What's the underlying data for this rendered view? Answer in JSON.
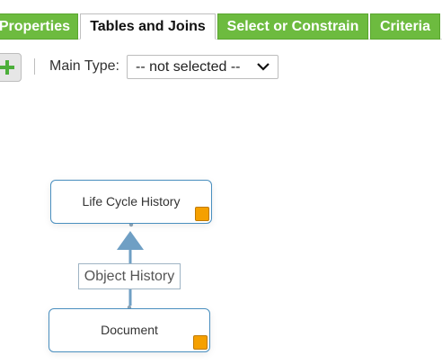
{
  "tabs": [
    {
      "label": "Properties",
      "active": false
    },
    {
      "label": "Tables and Joins",
      "active": true
    },
    {
      "label": "Select or Constrain",
      "active": false
    },
    {
      "label": "Criteria",
      "active": false
    }
  ],
  "toolbar": {
    "add_icon": "plus-icon",
    "main_type_label": "Main Type:",
    "main_type_value": "-- not selected --"
  },
  "diagram": {
    "nodes": [
      {
        "label": "Life Cycle History"
      },
      {
        "label": "Document"
      }
    ],
    "edge_label": "Object History"
  },
  "colors": {
    "tab_green": "#6dbb3f",
    "node_border": "#4a8fbf",
    "handle_orange": "#f5a000",
    "arrow_blue": "#6f9fc4",
    "add_plus_green": "#4caf3a"
  }
}
